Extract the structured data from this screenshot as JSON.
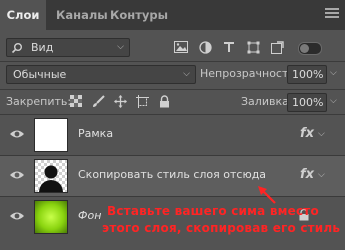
{
  "tabs": [
    {
      "label": "Слои",
      "active": true
    },
    {
      "label": "Каналы",
      "active": false
    },
    {
      "label": "Контуры",
      "active": false
    }
  ],
  "filter": {
    "kind_label": "Вид"
  },
  "blend": {
    "mode": "Обычные",
    "opacity_label": "Непрозрачность:",
    "opacity_value": "100%"
  },
  "lock": {
    "label": "Закрепить:",
    "fill_label": "Заливка:",
    "fill_value": "100%"
  },
  "layers": [
    {
      "name": "Рамка",
      "has_fx": true,
      "selected": false,
      "thumb": "white"
    },
    {
      "name": "Скопировать стиль слоя отсюда",
      "has_fx": true,
      "selected": true,
      "thumb": "silhouette"
    },
    {
      "name": "Фон",
      "has_fx": false,
      "selected": false,
      "thumb": "green-glow",
      "locked": true
    }
  ],
  "annotation": {
    "line1": "Вставьте вашего сима вместо",
    "line2": "этого слоя, скопировав его стиль",
    "color": "#ff2424"
  }
}
